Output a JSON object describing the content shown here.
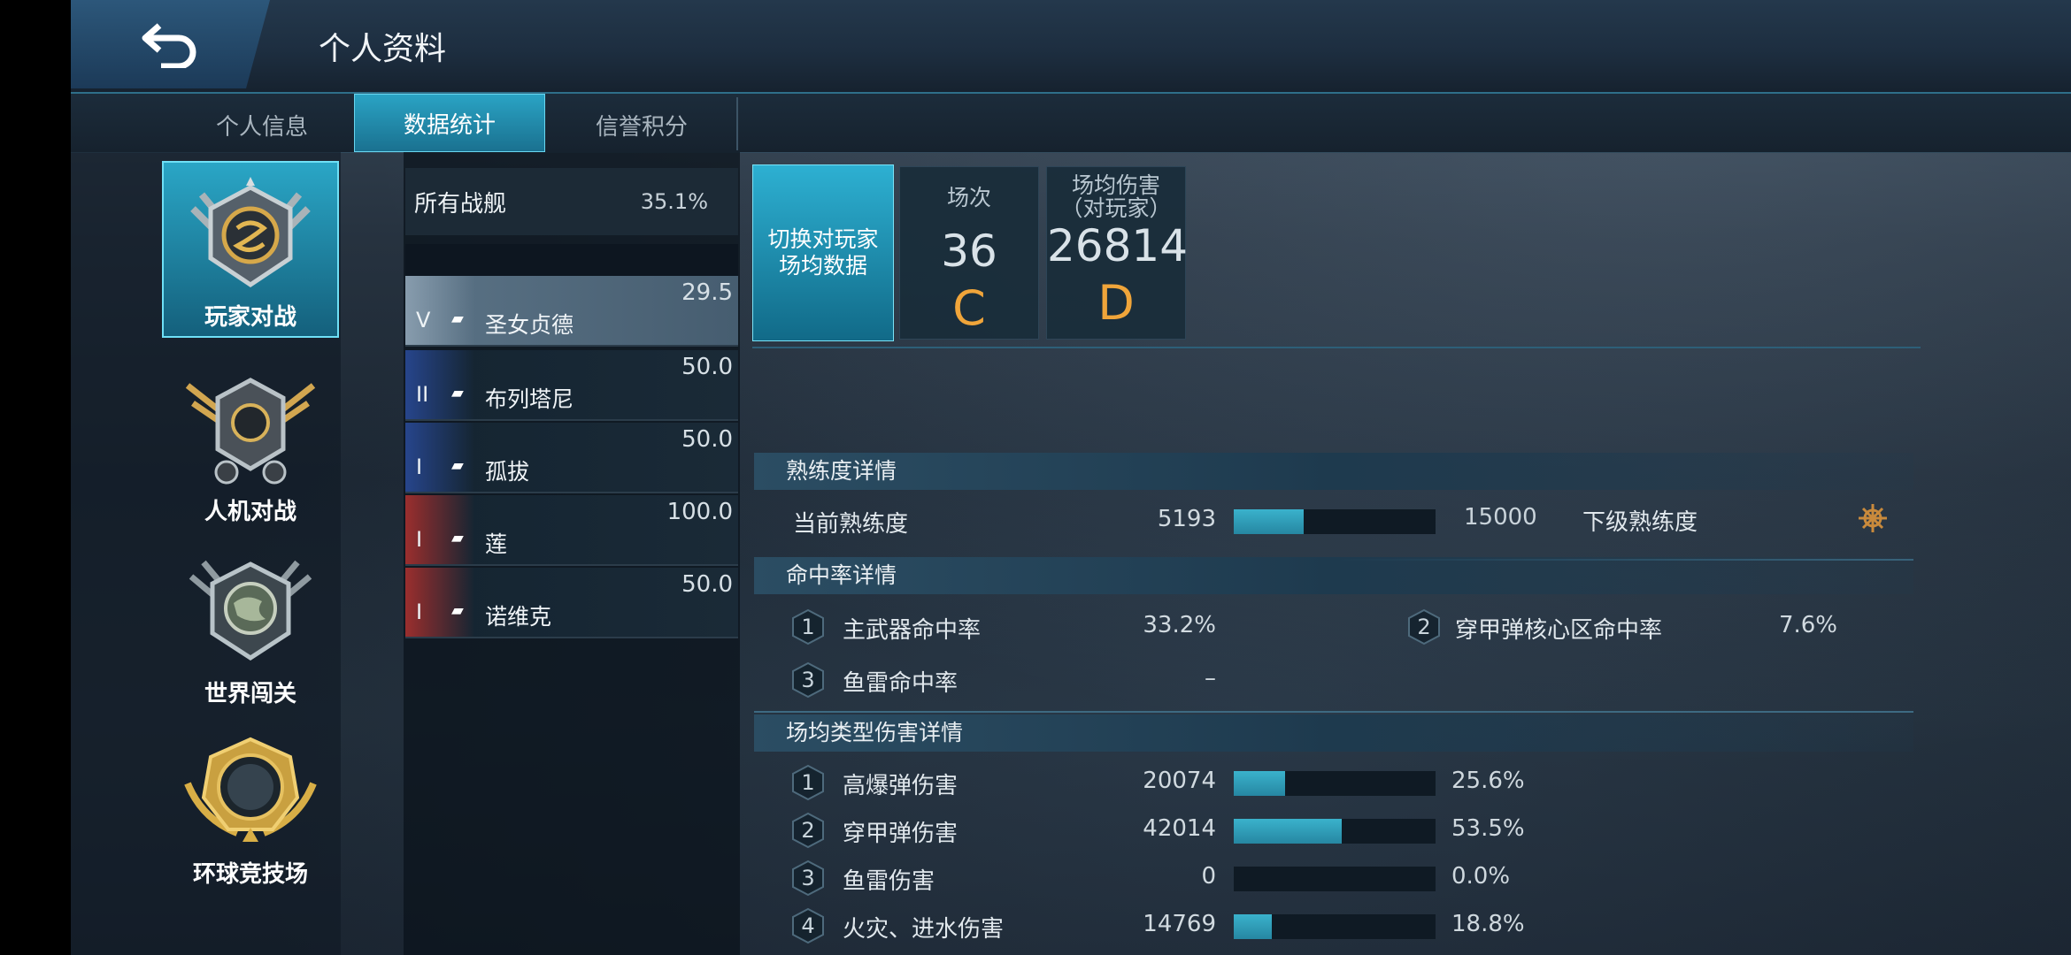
{
  "header": {
    "title": "个人资料"
  },
  "tabs": [
    {
      "label": "个人信息",
      "active": false
    },
    {
      "label": "数据统计",
      "active": true
    },
    {
      "label": "信誉积分",
      "active": false
    }
  ],
  "modes": [
    {
      "label": "玩家对战",
      "active": true,
      "icon": "pvp-emblem-icon"
    },
    {
      "label": "人机对战",
      "active": false,
      "icon": "pve-emblem-icon"
    },
    {
      "label": "世界闯关",
      "active": false,
      "icon": "world-emblem-icon"
    },
    {
      "label": "环球竞技场",
      "active": false,
      "icon": "arena-emblem-icon"
    }
  ],
  "all_ships": {
    "label": "所有战舰",
    "value": "35.1%"
  },
  "ships": [
    {
      "tier": "V",
      "name": "圣女贞德",
      "value": "29.5",
      "flag_color": "#8fa3b4",
      "selected": true
    },
    {
      "tier": "II",
      "name": "布列塔尼",
      "value": "50.0",
      "flag_color": "#2a4b9c",
      "selected": false
    },
    {
      "tier": "I",
      "name": "孤拔",
      "value": "50.0",
      "flag_color": "#2a4b9c",
      "selected": false
    },
    {
      "tier": "I",
      "name": "莲",
      "value": "100.0",
      "flag_color": "#b3302d",
      "selected": false
    },
    {
      "tier": "I",
      "name": "诺维克",
      "value": "50.0",
      "flag_color": "#b3302d",
      "selected": false
    }
  ],
  "switch_button": {
    "label": "切换对玩家场均数据"
  },
  "cards": [
    {
      "title": "场次",
      "title2": "",
      "value": "36",
      "grade": "C"
    },
    {
      "title": "场均伤害",
      "title2": "（对玩家）",
      "value": "26814",
      "grade": "D"
    }
  ],
  "proficiency": {
    "title": "熟练度详情",
    "current_label": "当前熟练度",
    "current_value": "5193",
    "next_value": "15000",
    "next_label": "下级熟练度",
    "fraction": 0.346
  },
  "hit_rate": {
    "title": "命中率详情",
    "items": [
      {
        "index": "1",
        "label": "主武器命中率",
        "value": "33.2%"
      },
      {
        "index": "2",
        "label": "穿甲弹核心区命中率",
        "value": "7.6%"
      },
      {
        "index": "3",
        "label": "鱼雷命中率",
        "value": "–"
      }
    ]
  },
  "damage": {
    "title": "场均类型伤害详情",
    "items": [
      {
        "index": "1",
        "label": "高爆弹伤害",
        "value": "20074",
        "pct": "25.6%",
        "fraction": 0.256
      },
      {
        "index": "2",
        "label": "穿甲弹伤害",
        "value": "42014",
        "pct": "53.5%",
        "fraction": 0.535
      },
      {
        "index": "3",
        "label": "鱼雷伤害",
        "value": "0",
        "pct": "0.0%",
        "fraction": 0.0
      },
      {
        "index": "4",
        "label": "火灾、进水伤害",
        "value": "14769",
        "pct": "18.8%",
        "fraction": 0.188
      }
    ]
  },
  "colors": {
    "accent": "#2aa3c4",
    "grade": "#f0a53a",
    "bar": "#3ab2cc"
  }
}
